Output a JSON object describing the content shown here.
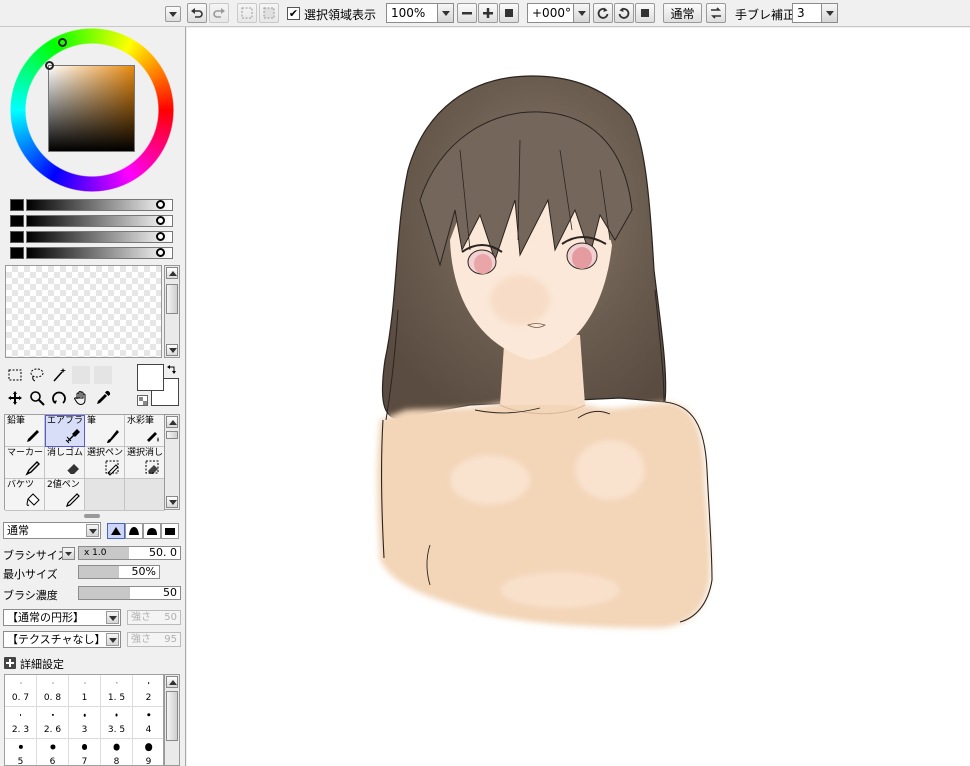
{
  "toolbar": {
    "show_selection_label": "選択領域表示",
    "show_selection_checked": "✔",
    "zoom": "100%",
    "rotation": "+000°",
    "blend_mode": "通常",
    "stabilizer_label": "手ブレ補正",
    "stabilizer_value": "3"
  },
  "color_panel": {
    "current_hue_color": "#e88a10",
    "sliders": [
      "#000000",
      "#000000",
      "#000000",
      "#000000"
    ]
  },
  "brush_tools": [
    {
      "label": "鉛筆",
      "icon": "pencil-icon",
      "active": false
    },
    {
      "label": "エアブラシ",
      "icon": "airbrush-icon",
      "active": true
    },
    {
      "label": "筆",
      "icon": "brush-icon",
      "active": false
    },
    {
      "label": "水彩筆",
      "icon": "watercolor-brush-icon",
      "active": false
    },
    {
      "label": "マーカー",
      "icon": "marker-icon",
      "active": false
    },
    {
      "label": "消しゴム",
      "icon": "eraser-icon",
      "active": false
    },
    {
      "label": "選択ペン",
      "icon": "select-pen-icon",
      "active": false
    },
    {
      "label": "選択消し",
      "icon": "select-eraser-icon",
      "active": false
    },
    {
      "label": "バケツ",
      "icon": "bucket-icon",
      "active": false
    },
    {
      "label": "2値ペン",
      "icon": "binary-pen-icon",
      "active": false
    }
  ],
  "brush_settings": {
    "blend_mode": "通常",
    "brush_size_label": "ブラシサイズ",
    "brush_size_multiplier": "x 1.0",
    "brush_size_value": "50. 0",
    "min_size_label": "最小サイズ",
    "min_size_value": "50%",
    "min_size_fraction": 0.5,
    "density_label": "ブラシ濃度",
    "density_value": "50",
    "density_fraction": 0.5,
    "shape_dropdown": "【通常の円形】",
    "shape_strength_label": "強さ",
    "shape_strength_value": "50",
    "texture_dropdown": "【テクスチャなし】",
    "texture_strength_label": "強さ",
    "texture_strength_value": "95",
    "advanced_settings_label": "詳細設定"
  },
  "brush_sizes": [
    "0. 7",
    "0. 8",
    "1",
    "1. 5",
    "2",
    "2. 3",
    "2. 6",
    "3",
    "3. 5",
    "4",
    "5",
    "6",
    "7",
    "8",
    "9"
  ]
}
